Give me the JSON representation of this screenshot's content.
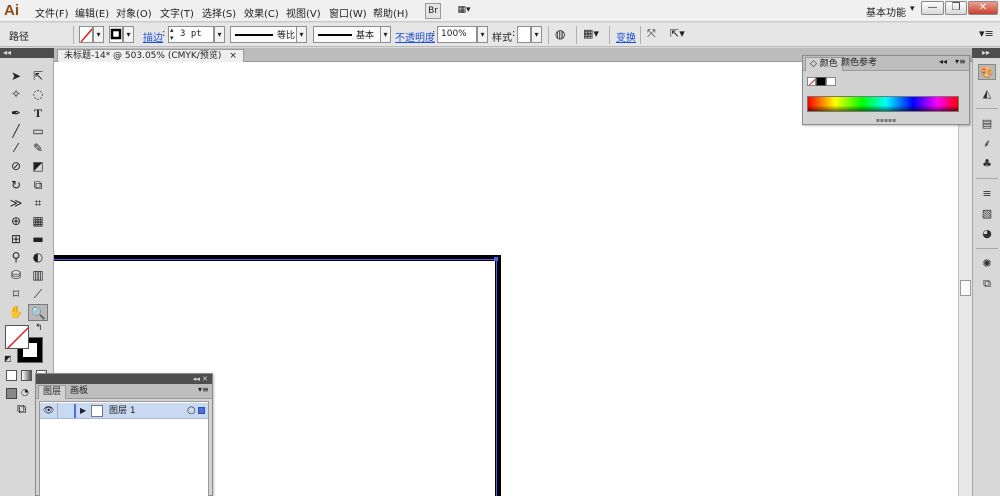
{
  "app": {
    "logo": "Ai",
    "workspace": "基本功能"
  },
  "menu": [
    {
      "label": "文件(F)"
    },
    {
      "label": "编辑(E)"
    },
    {
      "label": "对象(O)"
    },
    {
      "label": "文字(T)"
    },
    {
      "label": "选择(S)"
    },
    {
      "label": "效果(C)"
    },
    {
      "label": "视图(V)"
    },
    {
      "label": "窗口(W)"
    },
    {
      "label": "帮助(H)"
    }
  ],
  "menu_buttons": {
    "bridge": "Br",
    "arrange": "▦▾"
  },
  "window_controls": {
    "minimize": "—",
    "restore": "❐",
    "close": "✕"
  },
  "control_bar": {
    "selection_type": "路径",
    "stroke_label": "描边",
    "stroke_weight": "3 pt",
    "profile_label": "等比",
    "brush_label": "基本",
    "opacity_label": "不透明度",
    "opacity_value": "100%",
    "style_label": "样式",
    "transform_label": "变换"
  },
  "document": {
    "tab_title": "未标题-14* @ 503.05% (CMYK/预览)",
    "close": "×"
  },
  "color_panel": {
    "tabs": [
      "颜色",
      "颜色参考"
    ],
    "active_tab": "颜色",
    "tab_marker": "◇",
    "collapse": "◂◂",
    "menu": "▾≡"
  },
  "layers_panel": {
    "tabs": [
      "图层",
      "画板"
    ],
    "active_tab": "图层",
    "collapse": "◂◂ ✕",
    "menu": "▾≡",
    "layers": [
      {
        "name": "图层 1",
        "visible": true,
        "color": "#4f6fd8"
      }
    ]
  },
  "colors": {
    "accent_link": "#1d4fd6",
    "selection": "#4a63e8",
    "layer_highlight": "#c9d9f1"
  }
}
